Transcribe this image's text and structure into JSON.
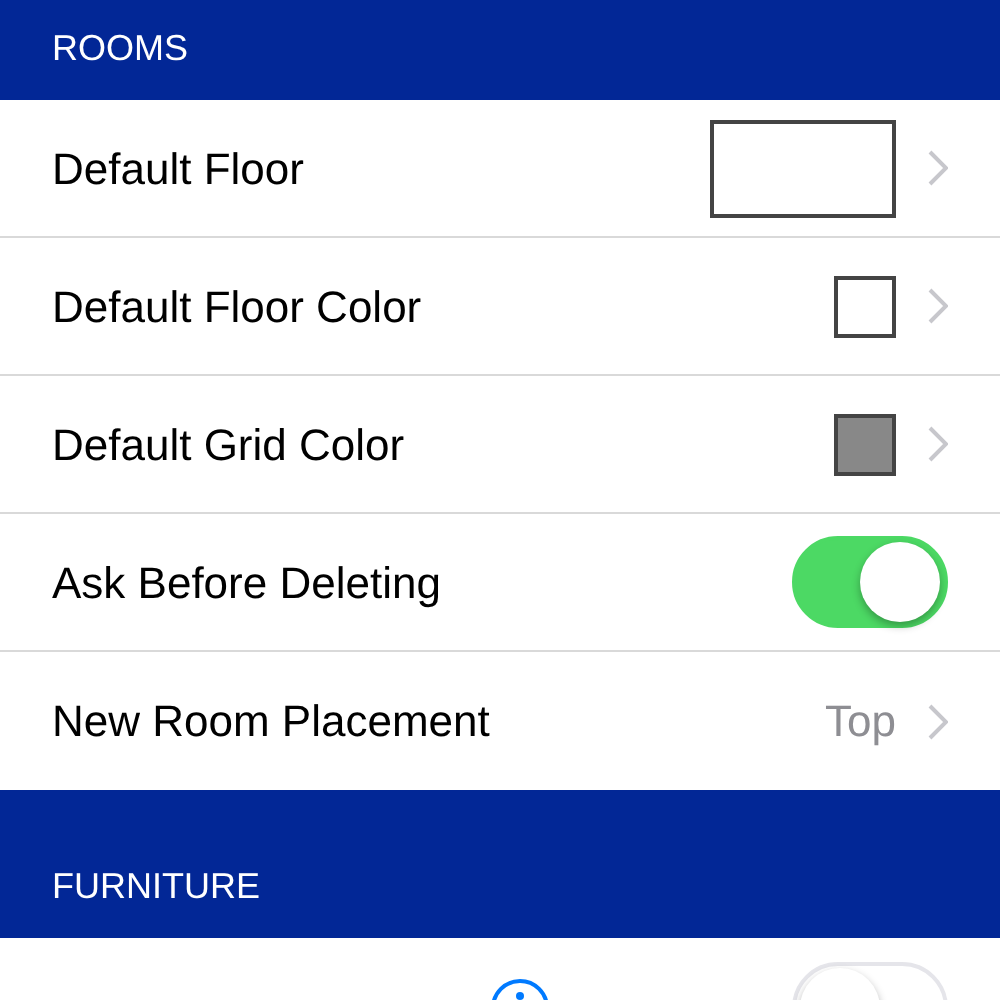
{
  "sections": [
    {
      "title": "ROOMS",
      "rows": [
        {
          "kind": "preview",
          "label": "Default Floor"
        },
        {
          "kind": "swatch",
          "label": "Default Floor Color",
          "color": "#ffffff"
        },
        {
          "kind": "swatch",
          "label": "Default Grid Color",
          "color": "#888888"
        },
        {
          "kind": "toggle",
          "label": "Ask Before Deleting",
          "on": true
        },
        {
          "kind": "value",
          "label": "New Room Placement",
          "value": "Top"
        }
      ]
    },
    {
      "title": "FURNITURE",
      "rows": [
        {
          "kind": "toggle",
          "info": true,
          "on": false
        }
      ]
    }
  ]
}
